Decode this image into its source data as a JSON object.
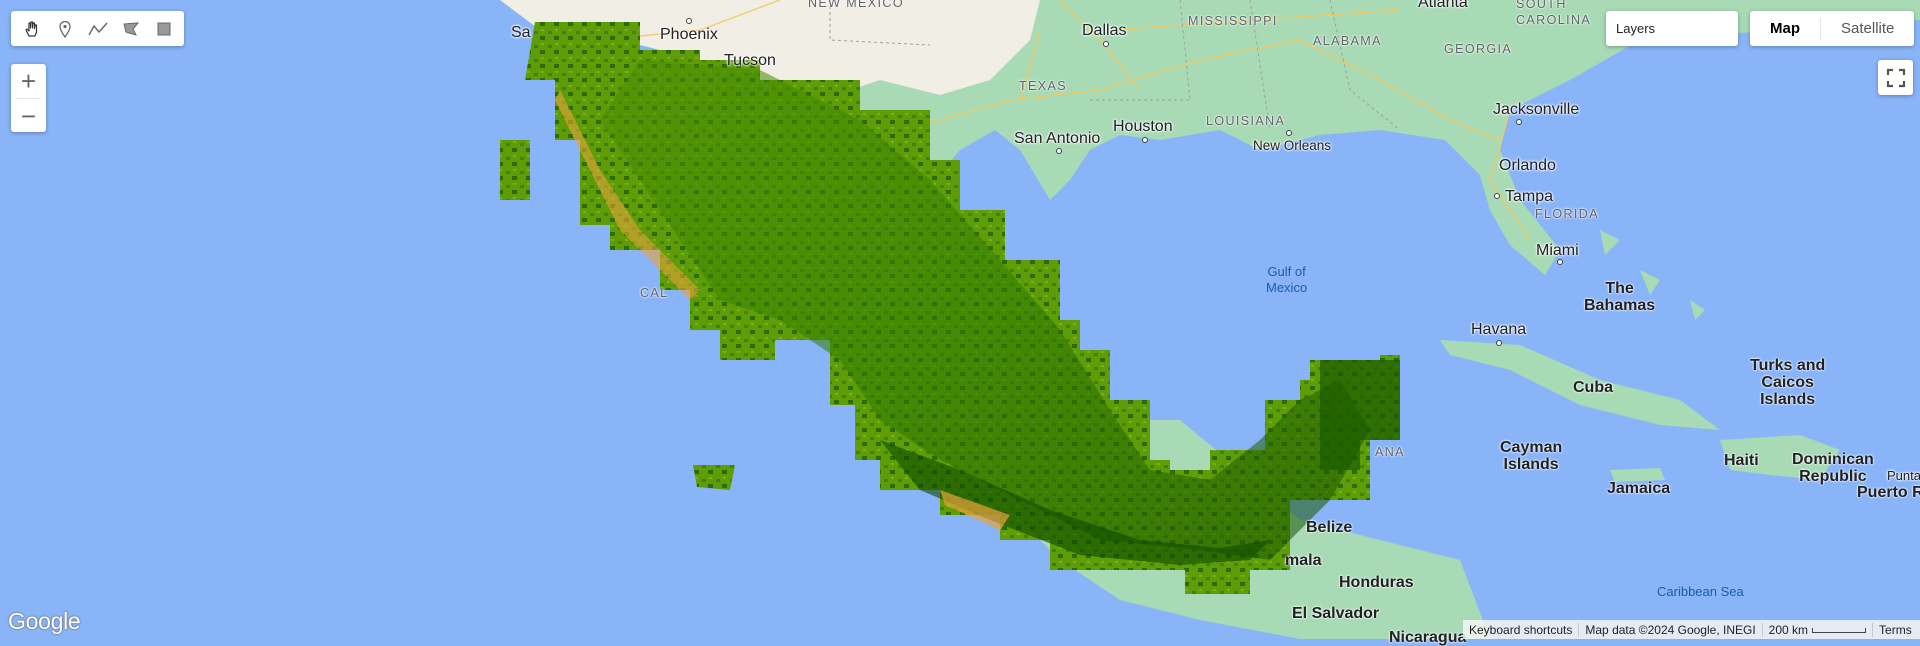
{
  "toolbar": {
    "tools": [
      {
        "icon": "hand-icon"
      },
      {
        "icon": "marker-icon"
      },
      {
        "icon": "polyline-icon"
      },
      {
        "icon": "polygon-icon"
      },
      {
        "icon": "rectangle-icon"
      }
    ]
  },
  "zoom": {
    "in_label": "+",
    "out_label": "−"
  },
  "layers": {
    "label": "Layers"
  },
  "maptype": {
    "map_label": "Map",
    "satellite_label": "Satellite",
    "active": "Map"
  },
  "map": {
    "cities": {
      "phoenix": "Phoenix",
      "tucson": "Tucson",
      "dallas": "Dallas",
      "houston": "Houston",
      "san_antonio": "San Antonio",
      "new_orleans": "New Orleans",
      "atlanta": "Atlanta",
      "jacksonville": "Jacksonville",
      "orlando": "Orlando",
      "tampa": "Tampa",
      "miami": "Miami",
      "havana": "Havana",
      "belize": "Belize",
      "san_diego_partial": "Sa"
    },
    "states": {
      "new_mexico": "NEW MEXICO",
      "texas": "TEXAS",
      "louisiana": "LOUISIANA",
      "mississippi": "MISSISSIPPI",
      "alabama": "ALABAMA",
      "georgia": "GEORGIA",
      "south_carolina": "SOUTH\nCAROLINA",
      "florida": "FLORIDA",
      "california_partial": "CAL",
      "quintana_partial": "ANA"
    },
    "countries": {
      "the_bahamas": "The\nBahamas",
      "cuba": "Cuba",
      "turks_caicos": "Turks and\nCaicos\nIslands",
      "cayman": "Cayman\nIslands",
      "haiti": "Haiti",
      "dominican": "Dominican\nRepublic",
      "jamaica": "Jamaica",
      "puerto_rico": "Puerto R",
      "honduras": "Honduras",
      "el_salvador": "El Salvador",
      "guatemala_partial": "mala",
      "nicaragua_partial": "Nicaragua",
      "punta_partial": "Punta"
    },
    "water": {
      "gulf_of_mexico": "Gulf of\nMexico",
      "caribbean_sea": "Caribbean Sea"
    },
    "overlay": {
      "name": "vegetation index raster over Mexico",
      "color_low": "#e8a33c",
      "color_mid": "#5e9d07",
      "color_high": "#0b4a00"
    }
  },
  "google_logo": "Google",
  "attribution": {
    "shortcuts": "Keyboard shortcuts",
    "map_data": "Map data ©2024 Google, INEGI",
    "scale": "200 km",
    "terms": "Terms"
  },
  "colors": {
    "ocean": "#8ab4f8",
    "land": "#f1eee6",
    "land_green": "#a8dab5",
    "roads": "#f9d97a"
  }
}
